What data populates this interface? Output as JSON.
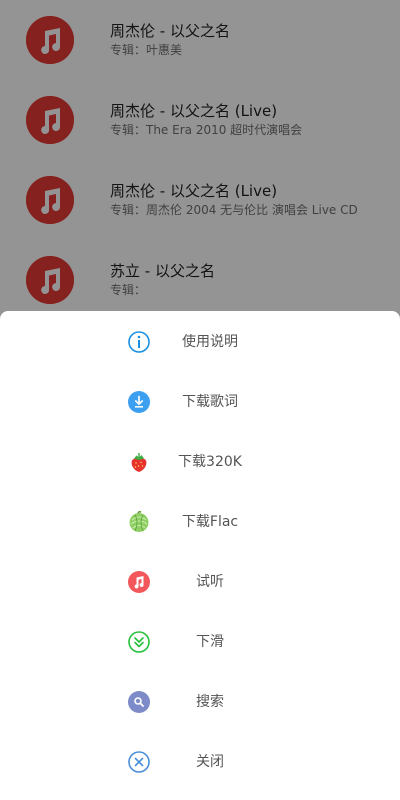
{
  "songs": [
    {
      "title": "周杰伦 - 以父之名",
      "album": "专辑：叶惠美"
    },
    {
      "title": "周杰伦 - 以父之名 (Live)",
      "album": "专辑：The Era 2010 超时代演唱会"
    },
    {
      "title": "周杰伦 - 以父之名 (Live)",
      "album": "专辑：周杰伦 2004 无与伦比 演唱会 Live CD"
    },
    {
      "title": "苏立 - 以父之名",
      "album": "专辑："
    }
  ],
  "sheet": {
    "items": [
      {
        "label": "使用说明",
        "icon": "info-icon"
      },
      {
        "label": "下载歌词",
        "icon": "download-icon"
      },
      {
        "label": "下载320K",
        "icon": "strawberry-icon"
      },
      {
        "label": "下载Flac",
        "icon": "melon-icon"
      },
      {
        "label": "试听",
        "icon": "music-note-icon"
      },
      {
        "label": "下滑",
        "icon": "double-chevron-down-icon"
      },
      {
        "label": "搜索",
        "icon": "search-icon"
      },
      {
        "label": "关闭",
        "icon": "close-icon"
      }
    ]
  },
  "colors": {
    "avatar": "#e53935",
    "info": "#1a8fe0",
    "download": "#3c9ff0",
    "listen": "#f2575b",
    "scroll_down": "#27c03a",
    "search": "#7d8cc8",
    "close": "#4a8fd8"
  }
}
